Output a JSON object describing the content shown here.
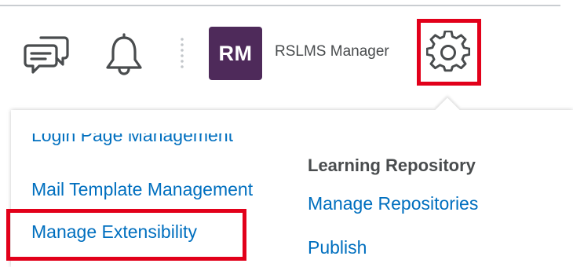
{
  "header": {
    "icons": [
      "chat-icon",
      "bell-icon",
      "gear-icon"
    ],
    "avatar_initials": "RM",
    "avatar_color": "#4e2a5a",
    "user_name": "RSLMS Manager"
  },
  "highlight_color": "#e2001a",
  "link_color": "#006fbf",
  "menu": {
    "admin_links": [
      {
        "label": "Login Page Management"
      },
      {
        "label": "Mail Template Management"
      },
      {
        "label": "Manage Extensibility"
      }
    ],
    "learning_repository": {
      "heading": "Learning Repository",
      "links": [
        {
          "label": "Manage Repositories"
        },
        {
          "label": "Publish"
        }
      ]
    }
  }
}
